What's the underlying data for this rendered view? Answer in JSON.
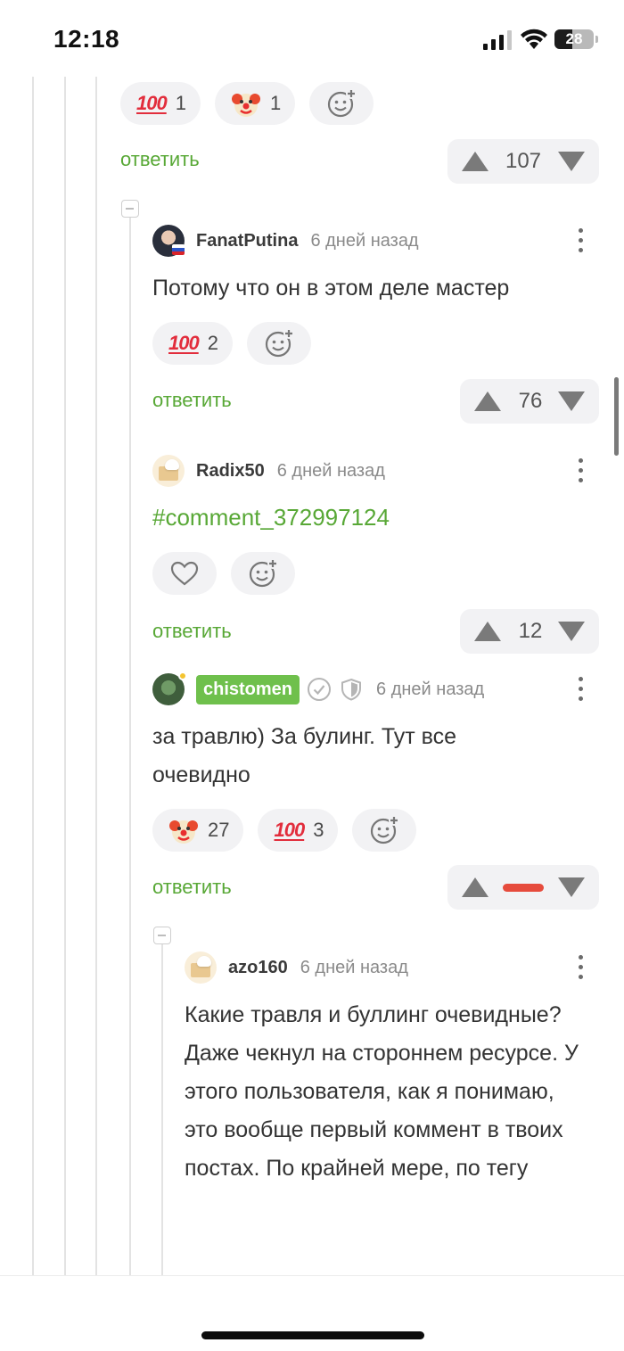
{
  "status_bar": {
    "time": "12:18",
    "battery": "28"
  },
  "top_block": {
    "reactions": [
      {
        "emoji": "100",
        "count": "1"
      },
      {
        "emoji": "clown",
        "count": "1"
      }
    ],
    "reply_label": "ответить",
    "votes": "107"
  },
  "comments": [
    {
      "username": "FanatPutina",
      "time": "6 дней назад",
      "text": "Потому что он в этом деле мастер",
      "reactions": [
        {
          "emoji": "100",
          "count": "2"
        }
      ],
      "reply_label": "ответить",
      "votes": "76"
    },
    {
      "username": "Radix50",
      "time": "6 дней назад",
      "text": "#comment_372997124",
      "reply_label": "ответить",
      "votes": "12"
    },
    {
      "username": "chistomen",
      "time": "6 дней назад",
      "text": "за травлю) За булинг. Тут все очевидно",
      "reactions": [
        {
          "emoji": "clown",
          "count": "27"
        },
        {
          "emoji": "100",
          "count": "3"
        }
      ],
      "reply_label": "ответить",
      "votes": ""
    },
    {
      "username": "azo160",
      "time": "6 дней назад",
      "text": "Какие травля и буллинг очевидные? Даже чекнул на стороннем ресурсе. У этого пользователя, как я понимаю, это вообще первый коммент в твоих постах. По крайней мере, по тегу"
    }
  ],
  "icons": {
    "reaction_100": "100-emoji-icon",
    "reaction_clown": "clown-emoji-icon",
    "add_reaction": "add-reaction-icon",
    "like": "heart-icon",
    "vote_up": "triangle-up-icon",
    "vote_down": "triangle-down-icon",
    "more": "more-vertical-icon"
  },
  "colors": {
    "accent_green": "#58a836",
    "badge_green": "#6fc04c",
    "negative_red": "#e64b3c",
    "chip_bg": "#f2f2f4"
  }
}
